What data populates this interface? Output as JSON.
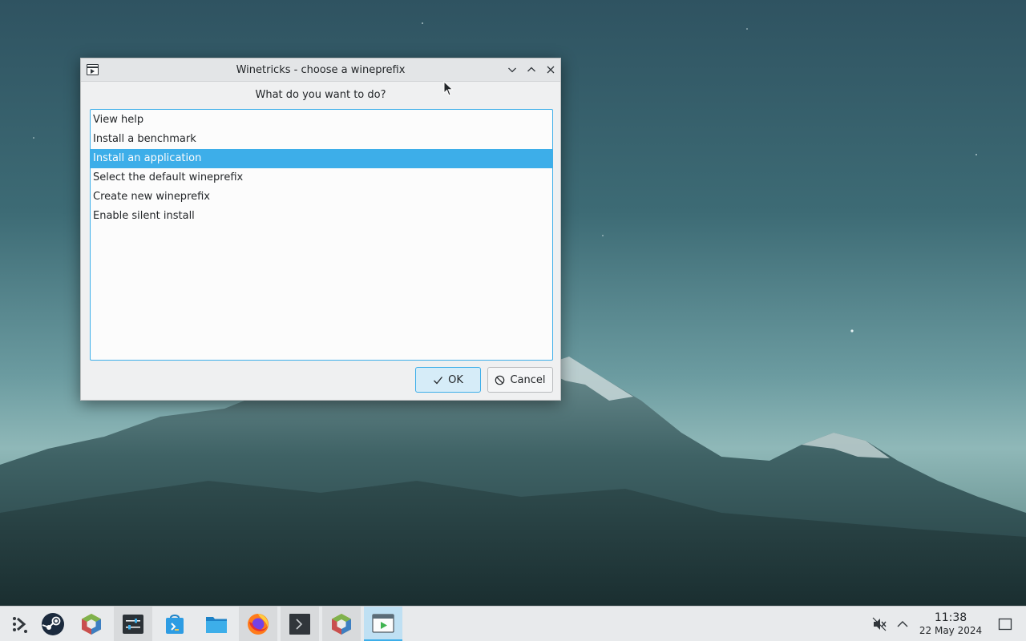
{
  "window": {
    "title": "Winetricks - choose a wineprefix",
    "prompt": "What do you want to do?",
    "options": [
      {
        "label": "View help",
        "selected": false
      },
      {
        "label": "Install a benchmark",
        "selected": false
      },
      {
        "label": "Install an application",
        "selected": true
      },
      {
        "label": "Select the default wineprefix",
        "selected": false
      },
      {
        "label": "Create new wineprefix",
        "selected": false
      },
      {
        "label": "Enable silent install",
        "selected": false
      }
    ],
    "ok_label": "OK",
    "cancel_label": "Cancel"
  },
  "taskbar": {
    "apps": [
      {
        "name": "application-launcher-icon"
      },
      {
        "name": "steam-icon"
      },
      {
        "name": "package-cube-icon"
      },
      {
        "name": "system-settings-icon"
      },
      {
        "name": "discover-store-icon"
      },
      {
        "name": "file-manager-icon"
      },
      {
        "name": "firefox-icon"
      },
      {
        "name": "terminal-icon"
      },
      {
        "name": "package-cube-icon-2"
      },
      {
        "name": "winetricks-window-icon"
      }
    ],
    "clock": {
      "time": "11:38",
      "date": "22 May 2024"
    }
  },
  "colors": {
    "accent": "#3daee9",
    "window_bg": "#eff0f1",
    "taskbar_bg": "#e8eaec"
  }
}
